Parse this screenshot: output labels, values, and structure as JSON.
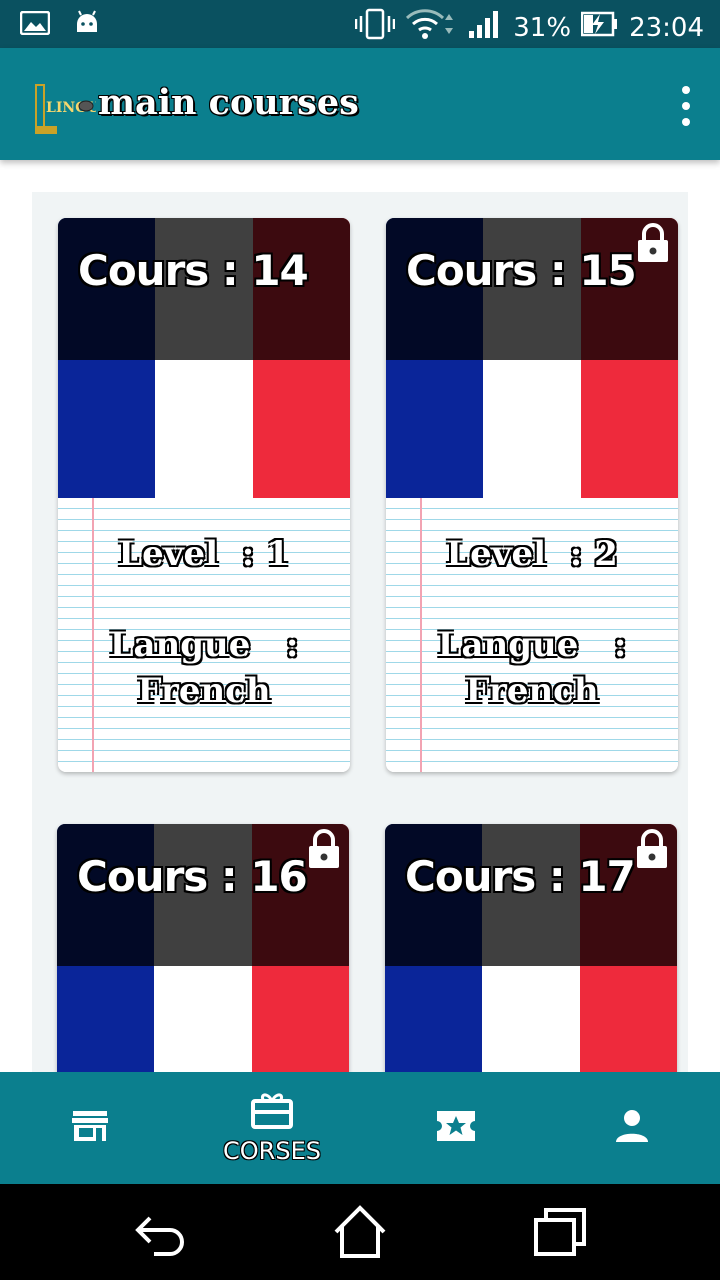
{
  "status_bar": {
    "battery": "31%",
    "time": "23:04",
    "icons": [
      "image-icon",
      "android-icon",
      "vibrate-icon",
      "wifi-icon",
      "signal-icon",
      "battery-charging-icon"
    ]
  },
  "app_bar": {
    "logo_text": "LINGUED",
    "title": "main courses",
    "menu_icon": "more-vert-icon"
  },
  "courses": [
    {
      "title": "Cours : 14",
      "level": "Level  : 1",
      "langue_label": "Langue   :",
      "langue_value": "French",
      "locked": false
    },
    {
      "title": "Cours : 15",
      "level": "Level  : 2",
      "langue_label": "Langue   :",
      "langue_value": "French",
      "locked": true
    },
    {
      "title": "Cours : 16",
      "locked": true
    },
    {
      "title": "Cours : 17",
      "locked": true
    }
  ],
  "bottom_nav": {
    "items": [
      {
        "icon": "store-icon",
        "label": ""
      },
      {
        "icon": "gift-card-icon",
        "label": "CORSES"
      },
      {
        "icon": "star-ticket-icon",
        "label": ""
      },
      {
        "icon": "person-icon",
        "label": ""
      }
    ],
    "active_index": 1
  },
  "colors": {
    "status_bar": "#0a5160",
    "app_bar": "#0b7f8e",
    "flag_blue": "#0a2599",
    "flag_white": "#ffffff",
    "flag_red": "#ee2a3c"
  }
}
